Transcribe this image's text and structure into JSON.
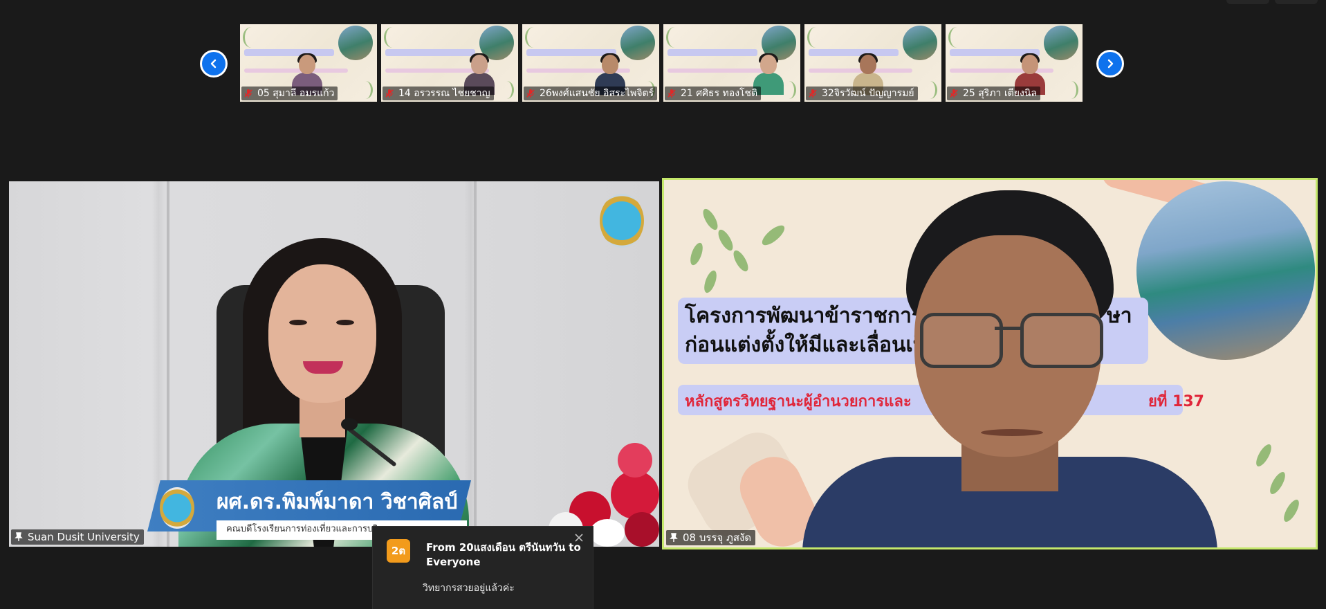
{
  "thumbnails": [
    {
      "name": "05 สุมาลี อมรแก้ว",
      "muted": true
    },
    {
      "name": "14 อรวรรณ ไชยชาญ",
      "muted": true
    },
    {
      "name": "26พงศ์แสนชัย อิสระไพจิตร์",
      "muted": true
    },
    {
      "name": "21 ศศิธร ทองโชติ",
      "muted": true
    },
    {
      "name": "32จิรวัฒน์ ปัญญารมย์",
      "muted": true
    },
    {
      "name": "25 สุริภา เตียงนิล",
      "muted": true
    }
  ],
  "strip_nav": {
    "prev_icon": "chevron-left-icon",
    "next_icon": "chevron-right-icon"
  },
  "main_left": {
    "participant_label": "Suan Dusit University",
    "banner_name": "ผศ.ดร.พิมพ์มาดา วิชาศิลป์",
    "banner_subtitle": "คณบดีโรงเรียนการท่องเที่ยวและการบริการ"
  },
  "main_right": {
    "participant_label": "08 บรรจุ ภูสงัด",
    "slide_title_line1": "โครงการพัฒนาข้าราชการค",
    "slide_title_line1_tail": "ษา",
    "slide_title_line2": "ก่อนแต่งตั้งให้มีและเลื่อนเป็",
    "slide_subtitle": "หลักสูตรวิทยฐานะผู้อำนวยการและ",
    "slide_subtitle_tail": "ยที่ 137",
    "active_speaker_color": "#c5e86c"
  },
  "chat": {
    "avatar_text": "2ต",
    "from_line": "From 20แสงเดือน ตรีนันทวัน to Everyone",
    "message": "วิทยากรสวยอยู่แล้วค่ะ"
  },
  "colors": {
    "background": "#1a1a1a",
    "nav_blue": "#0e72ed",
    "avatar_orange": "#f29b1c"
  }
}
